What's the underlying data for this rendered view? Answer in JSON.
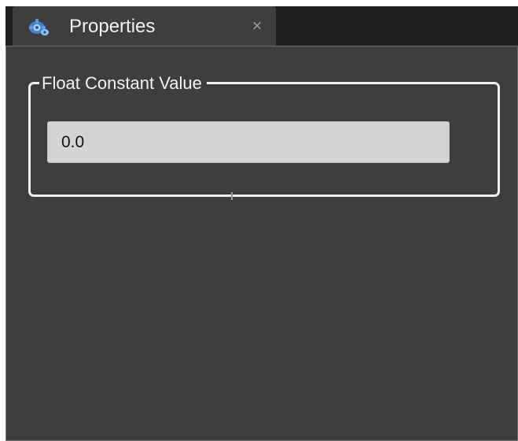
{
  "tab": {
    "title": "Properties",
    "close_glyph": "×",
    "icon": "properties-gear-icon"
  },
  "group": {
    "legend": "Float Constant Value",
    "field_value": "0.0"
  },
  "colors": {
    "tab_bar_bg": "#1e1e1e",
    "panel_bg": "#3e3e3e",
    "field_bg": "#d3d3d3",
    "text_light": "#f2f2f2",
    "icon_blue": "#4a8fd6"
  }
}
